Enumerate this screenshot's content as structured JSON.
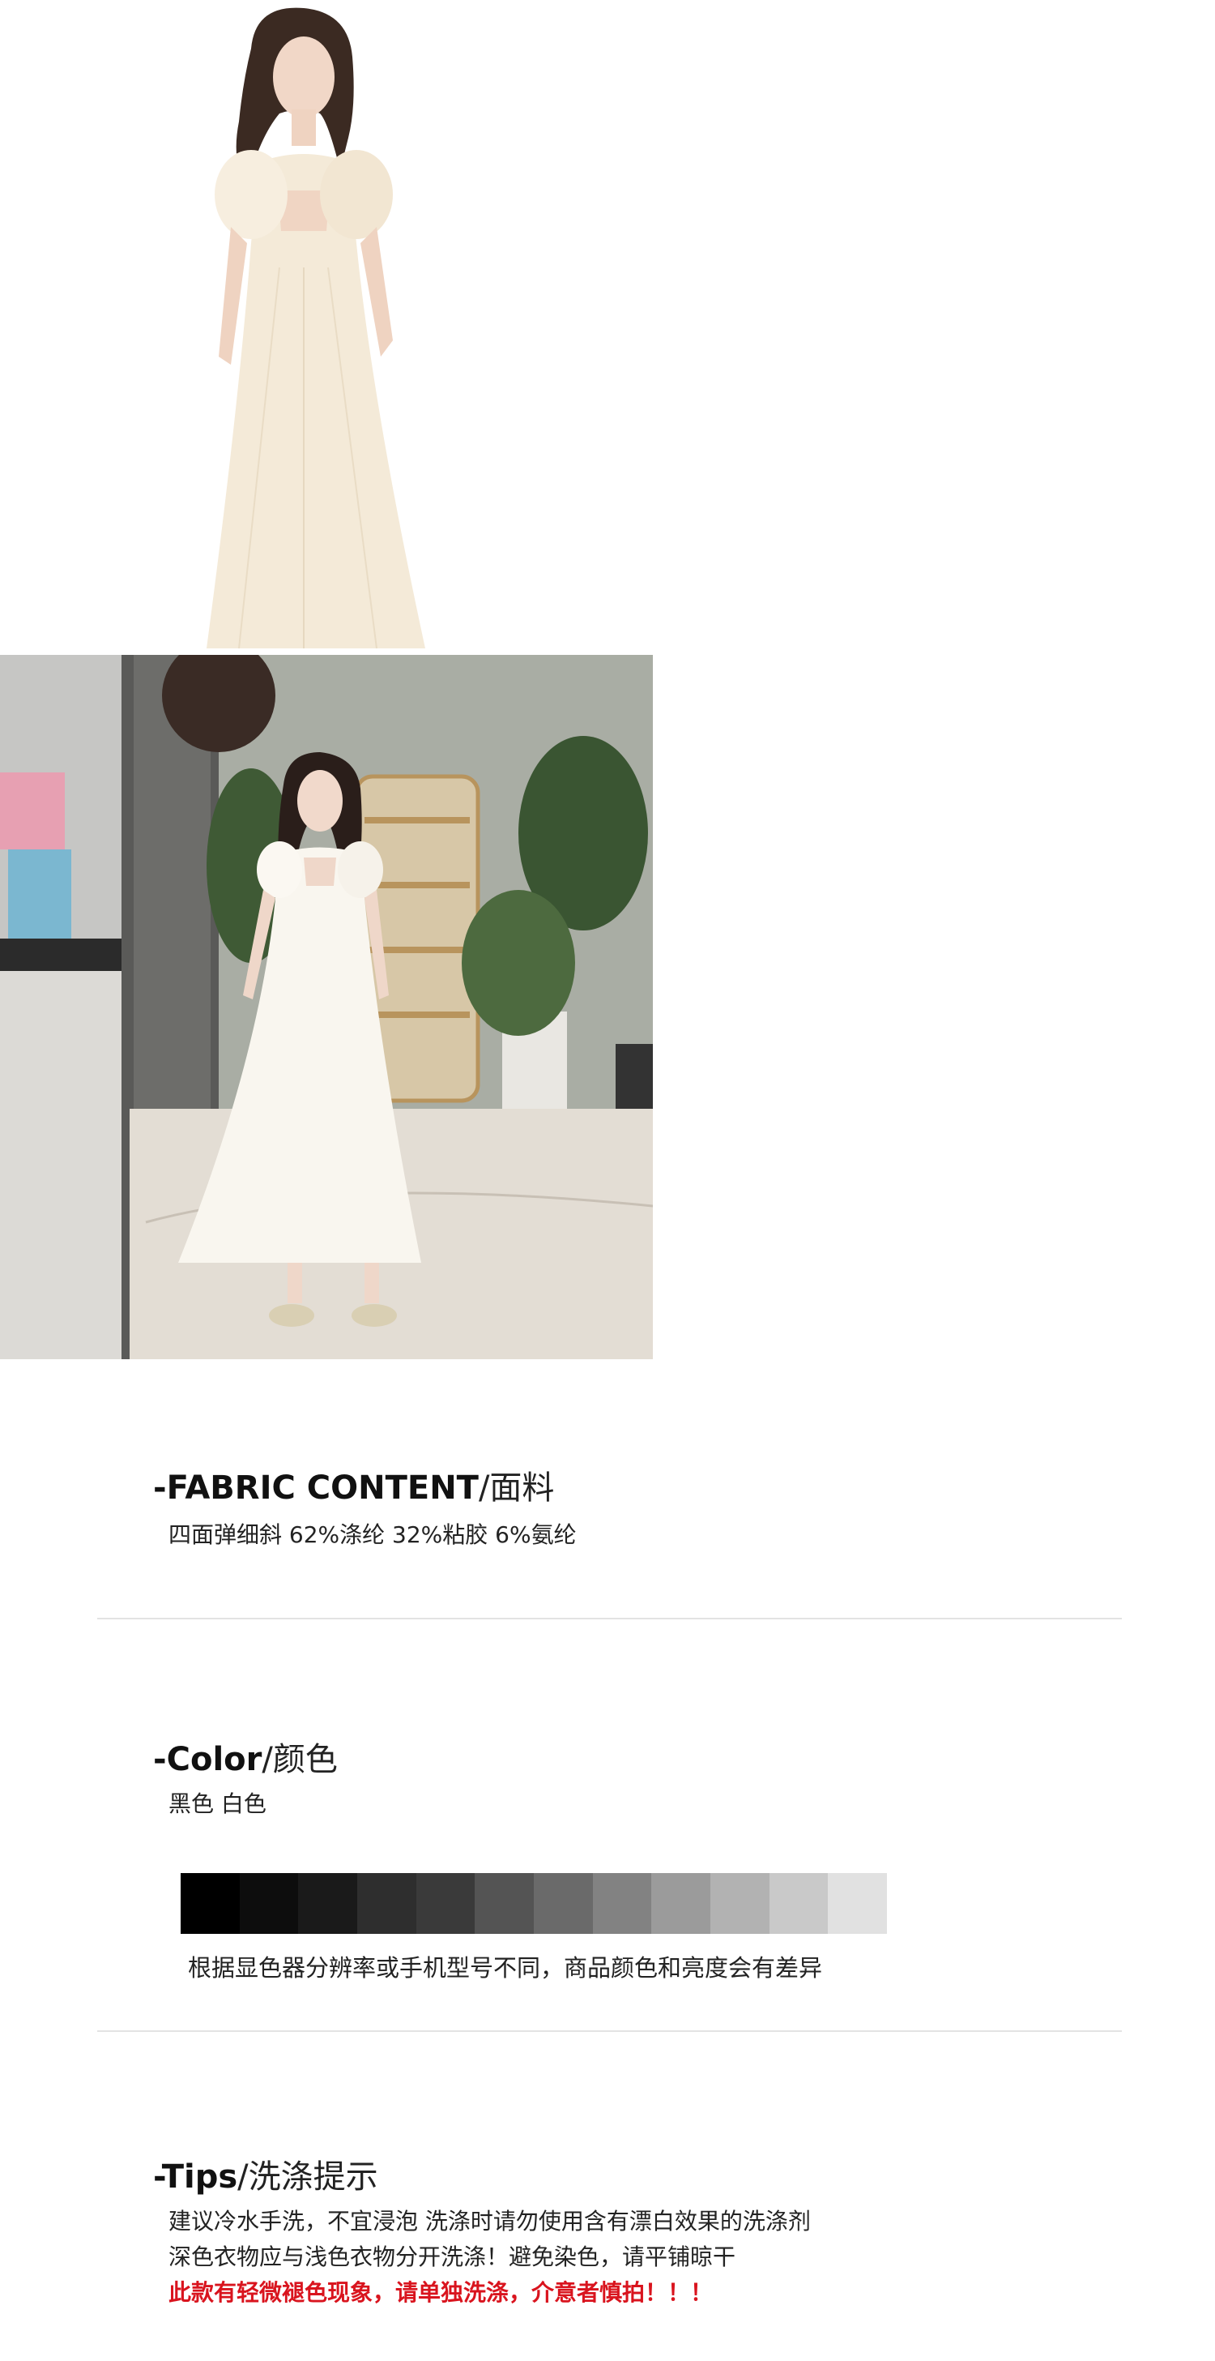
{
  "fabric": {
    "title_en": "-FABRIC CONTENT",
    "title_zh": "/面料",
    "content": "四面弹细斜 62%涤纶 32%粘胶 6%氨纶"
  },
  "color": {
    "title_en": "-Color",
    "title_zh": "/颜色",
    "options": "黑色 白色",
    "swatches": [
      "#000000",
      "#0d0d0d",
      "#1a1a1a",
      "#2e2e2e",
      "#3a3a3a",
      "#545454",
      "#6a6a6a",
      "#828282",
      "#9b9b9b",
      "#b2b2b2",
      "#c9c9c9",
      "#e1e1e1"
    ],
    "note": "根据显色器分辨率或手机型号不同，商品颜色和亮度会有差异"
  },
  "tips": {
    "title_en": "-Tips",
    "title_zh": "/洗涤提示",
    "line1": "建议冷水手洗，不宜浸泡 洗涤时请勿使用含有漂白效果的洗涤剂",
    "line2": "深色衣物应与浅色衣物分开洗涤！避免染色，请平铺晾干",
    "warning": "此款有轻微褪色现象，请单独洗涤，介意者慎拍！！！"
  }
}
